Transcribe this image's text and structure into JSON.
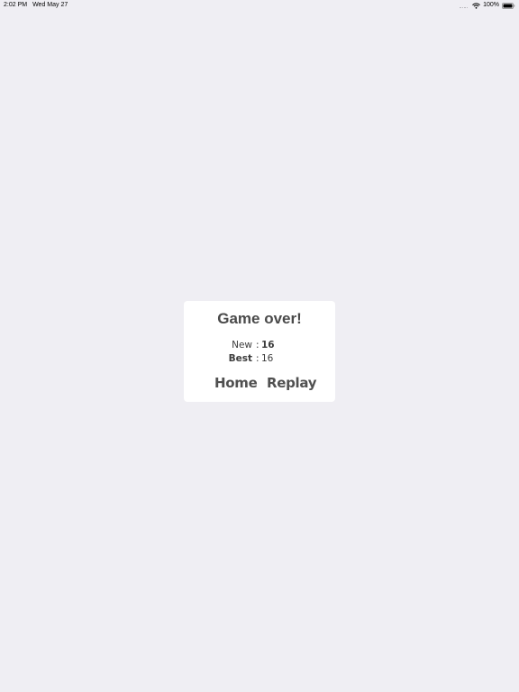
{
  "status_bar": {
    "time": "2:02 PM",
    "date": "Wed May 27",
    "battery": "100%"
  },
  "dialog": {
    "title": "Game over!",
    "new_label": "New",
    "new_value": "16",
    "best_label": "Best",
    "best_value": "16",
    "separator": ":",
    "home_label": "Home",
    "replay_label": "Replay"
  }
}
